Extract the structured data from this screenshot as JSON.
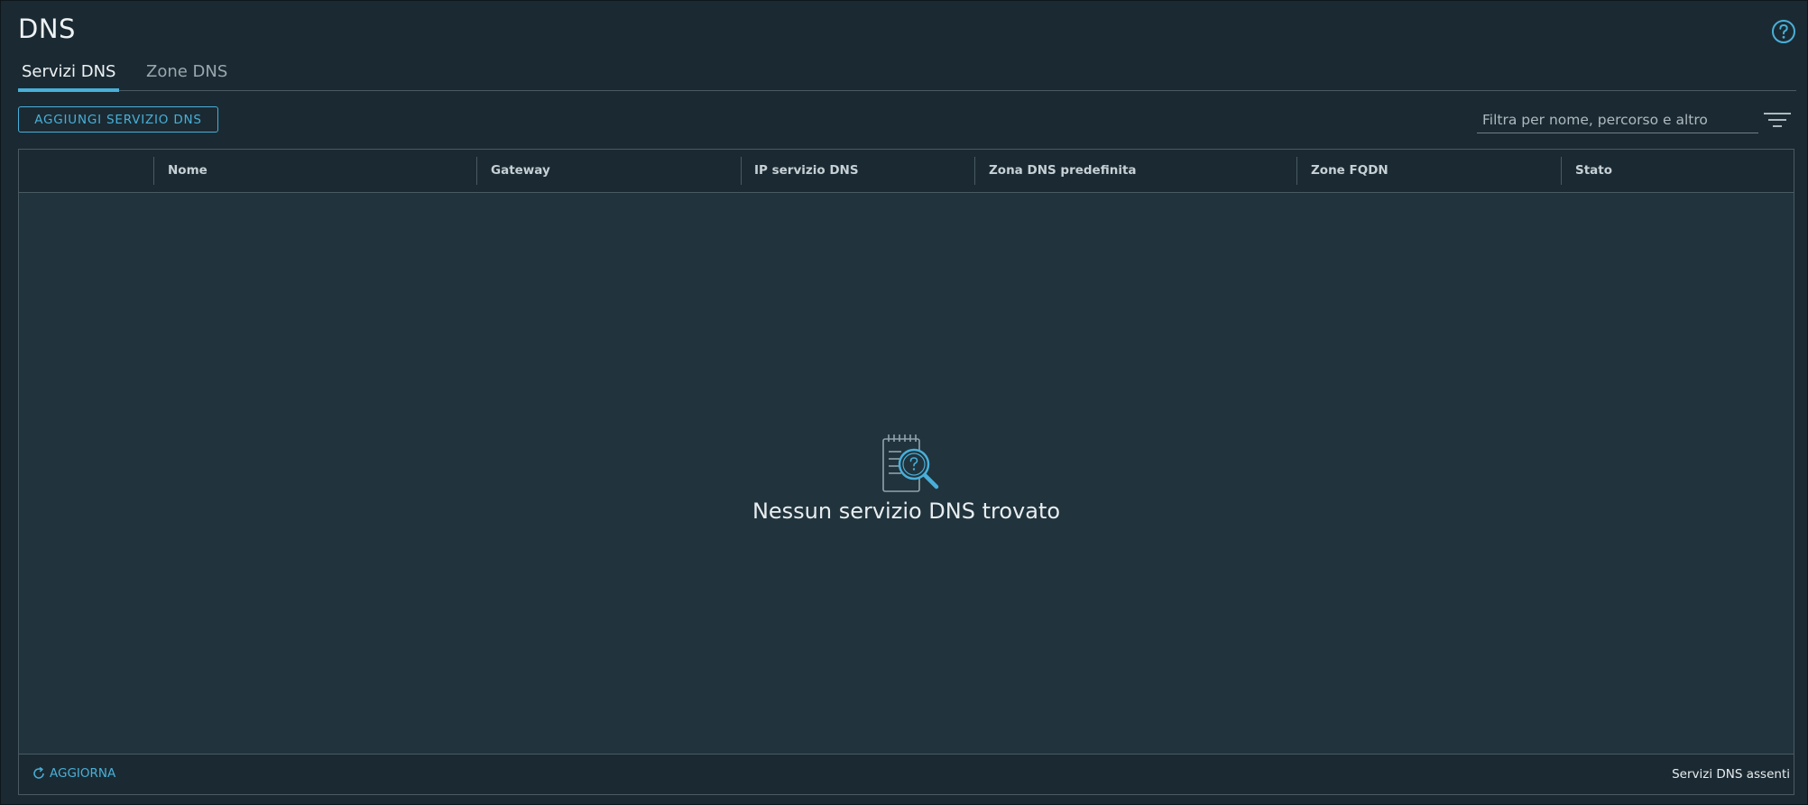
{
  "page": {
    "title": "DNS"
  },
  "tabs": [
    {
      "label": "Servizi DNS",
      "active": true
    },
    {
      "label": "Zone DNS",
      "active": false
    }
  ],
  "toolbar": {
    "add_label": "AGGIUNGI SERVIZIO DNS",
    "filter_placeholder": "Filtra per nome, percorso e altro",
    "filter_value": ""
  },
  "table": {
    "columns": [
      "Nome",
      "Gateway",
      "IP servizio DNS",
      "Zona DNS predefinita",
      "Zone FQDN",
      "Stato"
    ],
    "rows": [],
    "empty_message": "Nessun servizio DNS trovato"
  },
  "footer": {
    "refresh_label": "AGGIORNA",
    "status": "Servizi DNS assenti"
  },
  "icons": {
    "help": "help-icon",
    "filter": "filter-icon",
    "empty": "empty-search-icon",
    "refresh": "refresh-icon"
  },
  "colors": {
    "background": "#1b2a32",
    "grid_body": "#21333c",
    "accent": "#49afd9",
    "border": "#4a5a63",
    "text": "#e8edf0"
  }
}
